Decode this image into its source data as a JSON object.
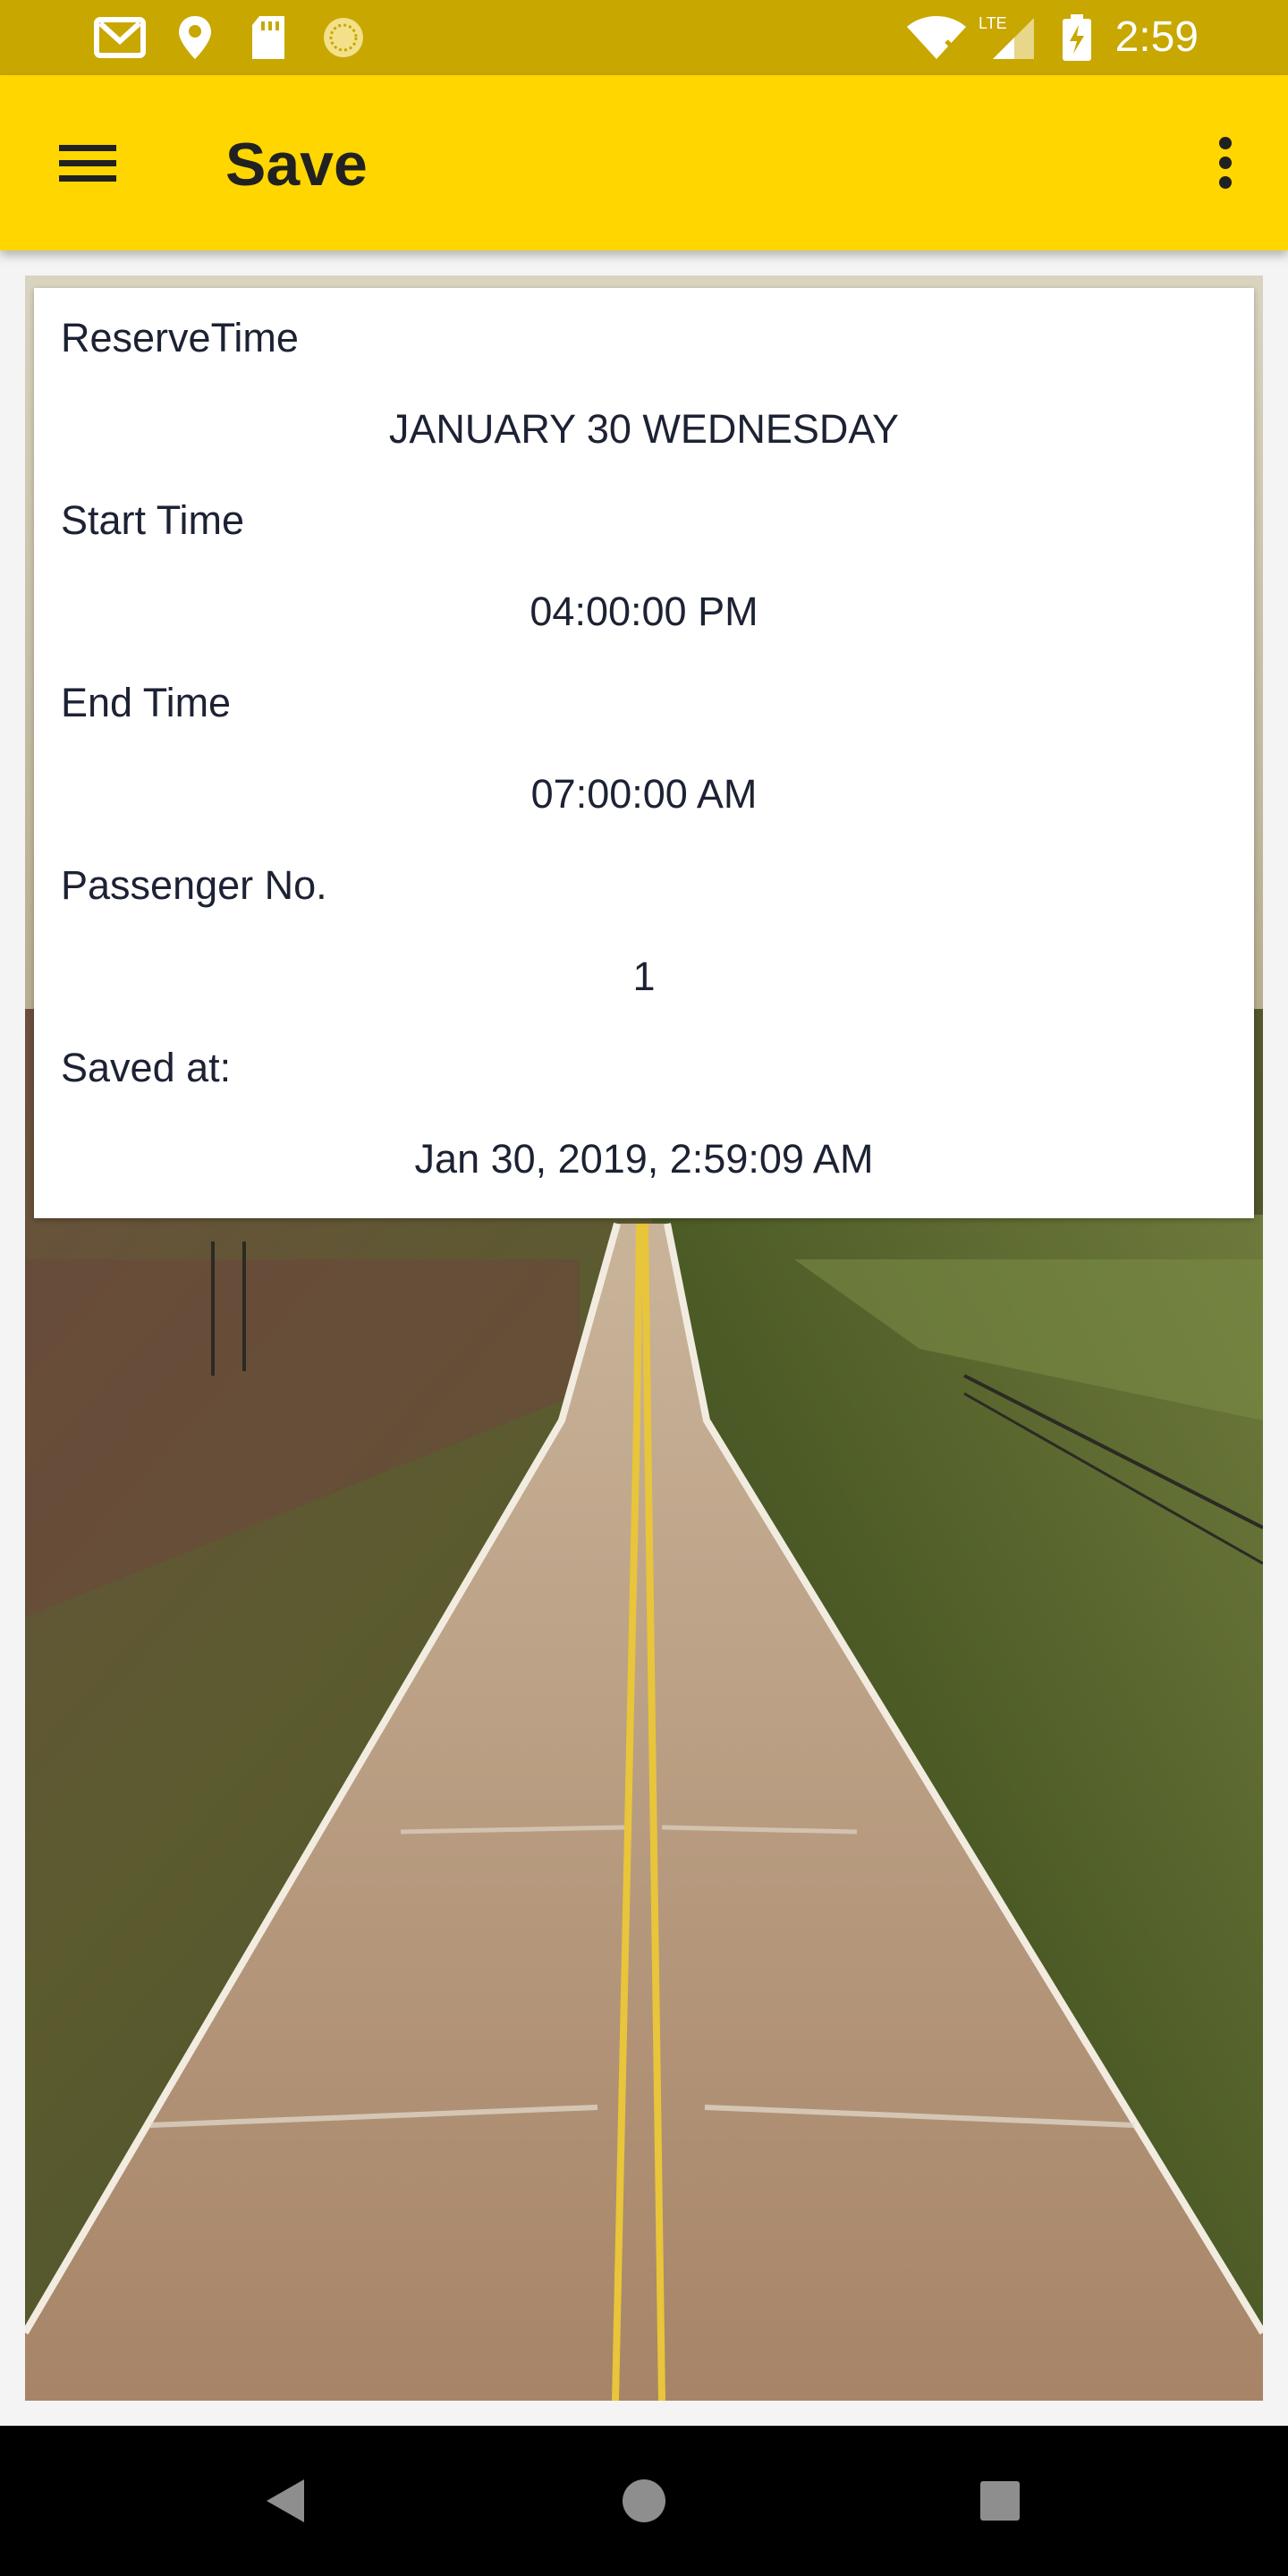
{
  "status_bar": {
    "time": "2:59",
    "icons": [
      "gmail-icon",
      "location-icon",
      "sd-card-icon",
      "sync-icon",
      "wifi-icon",
      "lte-signal-icon",
      "battery-charging-icon"
    ],
    "network_label": "LTE"
  },
  "app_bar": {
    "title": "Save",
    "menu_icon": "hamburger-menu-icon",
    "overflow_icon": "more-vert-icon",
    "background": "#ffd600"
  },
  "reservation": {
    "reserve_time_label": "ReserveTime",
    "reserve_time_value": "JANUARY 30 WEDNESDAY",
    "start_time_label": "Start Time",
    "start_time_value": "04:00:00 PM",
    "end_time_label": "End Time",
    "end_time_value": "07:00:00 AM",
    "passenger_label": "Passenger No.",
    "passenger_value": "1",
    "saved_at_label": "Saved at:",
    "saved_at_value": "Jan 30, 2019, 2:59:09 AM"
  },
  "background_image": {
    "subject": "straight road through green fields"
  },
  "nav_bar": {
    "back_icon": "back-triangle-icon",
    "home_icon": "home-circle-icon",
    "recents_icon": "recents-square-icon"
  }
}
